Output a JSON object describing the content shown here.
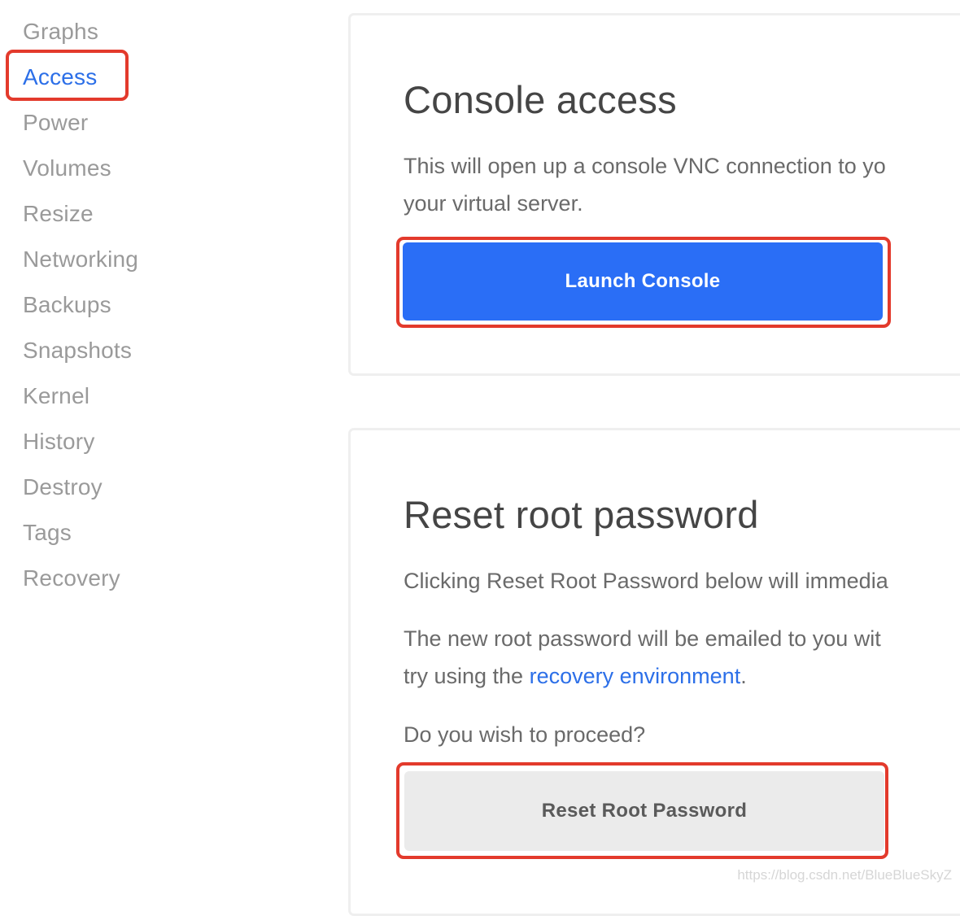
{
  "sidebar": {
    "items": [
      {
        "label": "Graphs",
        "active": false
      },
      {
        "label": "Access",
        "active": true
      },
      {
        "label": "Power",
        "active": false
      },
      {
        "label": "Volumes",
        "active": false
      },
      {
        "label": "Resize",
        "active": false
      },
      {
        "label": "Networking",
        "active": false
      },
      {
        "label": "Backups",
        "active": false
      },
      {
        "label": "Snapshots",
        "active": false
      },
      {
        "label": "Kernel",
        "active": false
      },
      {
        "label": "History",
        "active": false
      },
      {
        "label": "Destroy",
        "active": false
      },
      {
        "label": "Tags",
        "active": false
      },
      {
        "label": "Recovery",
        "active": false
      }
    ]
  },
  "console_card": {
    "title": "Console access",
    "description_line1": "This will open up a console VNC connection to yo",
    "description_line2": "your virtual server.",
    "button_label": "Launch Console"
  },
  "reset_card": {
    "title": "Reset root password",
    "paragraph1": "Clicking Reset Root Password below will immedia",
    "paragraph2_line1": "The new root password will be emailed to you wit",
    "paragraph2_line2_prefix": "try using the ",
    "paragraph2_link": "recovery environment",
    "paragraph2_line2_suffix": ".",
    "question": "Do you wish to proceed?",
    "button_label": "Reset Root Password"
  },
  "colors": {
    "accent": "#2c6fe8",
    "primary_button": "#2a6ef6",
    "secondary_button": "#ebebeb",
    "annotation": "#e33a2c",
    "nav_text": "#9a9a9a"
  },
  "watermark": "https://blog.csdn.net/BlueBlueSkyZ"
}
